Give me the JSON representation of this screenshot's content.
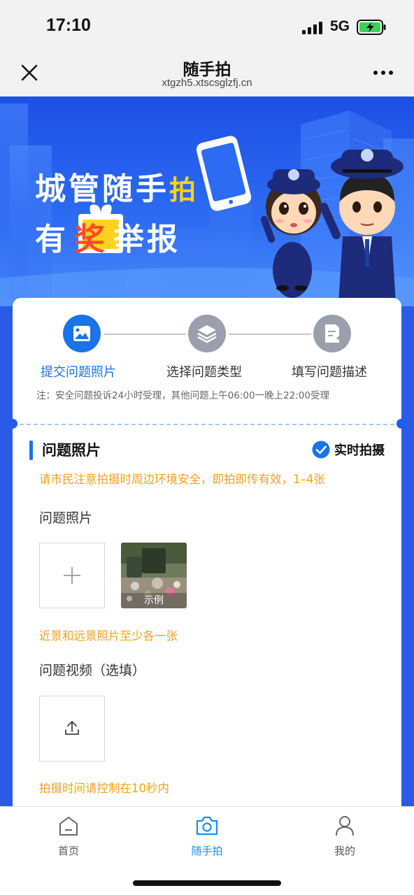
{
  "status_bar": {
    "time": "17:10",
    "network": "5G"
  },
  "nav": {
    "title": "随手拍",
    "url": "xtgzh5.xtscsglzfj.cn",
    "close_icon": "close-icon",
    "more_icon": "more-icon"
  },
  "banner": {
    "line1_a": "城管随手",
    "line1_b": "拍",
    "line2_a": "有",
    "line2_b": "奖",
    "line2_c": "举报"
  },
  "steps": {
    "items": [
      {
        "label": "提交问题照片",
        "icon": "image-icon",
        "active": true
      },
      {
        "label": "选择问题类型",
        "icon": "layers-icon",
        "active": false
      },
      {
        "label": "填写问题描述",
        "icon": "edit-icon",
        "active": false
      }
    ],
    "note": "注：安全问题投诉24小时受理，其他问题上午06:00一晚上22:00受理"
  },
  "form": {
    "section_title": "问题照片",
    "realtime_label": "实时拍摄",
    "photo_tip": "请市民注意拍摄时周边环境安全，即拍即传有效，1–4张",
    "photo_label": "问题照片",
    "sample_caption": "示例",
    "photo_hint": "近景和远景照片至少各一张",
    "video_label": "问题视频（选填）",
    "video_hint": "拍摄时间请控制在10秒内"
  },
  "tabs": [
    {
      "label": "首页",
      "icon": "home-icon",
      "active": false
    },
    {
      "label": "随手拍",
      "icon": "camera-icon",
      "active": true
    },
    {
      "label": "我的",
      "icon": "user-icon",
      "active": false
    }
  ],
  "colors": {
    "accent": "#1a73e8",
    "warning_text": "#f0a020",
    "banner_blue": "#1d50e6",
    "tab_active": "#1a8fe8"
  }
}
